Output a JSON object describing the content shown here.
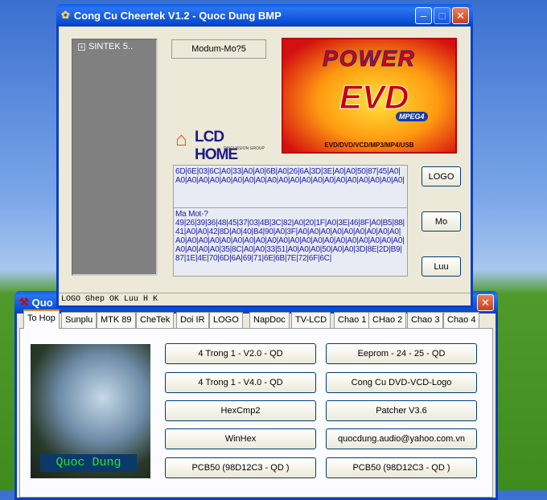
{
  "main_window": {
    "title": "Cong Cu Cheertek V1.2 - Quoc Dung BMP",
    "tree_item": "SINTEK 5..",
    "modum_button": "Modum-Mo?5",
    "banner": {
      "power": "POWER",
      "evd": "EVD",
      "mpeg": "MPEG4",
      "formats": "EVD/DVD/VCD/MP3/MP4/USB"
    },
    "lcd_logo": {
      "brand": "LCD HOME",
      "sub": "DISCUSSION GROUP"
    },
    "data_box1": "6D|6E|03|6C|A0|33|A0|A0|6B|A0|26|6A|3D|3E|A0|A0|50|87|45|A0|A0|A0|A0|A0|A0|A0|A0|A0|A0|A0|A0|A0|A0|A0|A0|A0|A0|A0|A0|A0|",
    "data_box2_label": "Ma Mot-?",
    "data_box2": "49|26|39|36|48|45|37|03|4B|3C|82|A0|20|1F|A0|3E|46|8F|A0|B5|88|41|A0|A0|42|8D|A0|40|B4|90|A0|3F|A0|A0|A0|A0|A0|A0|A0|A0|A0|A0|A0|A0|A0|A0|A0|A0|A0|A0|A0|A0|A0|A0|A0|A0|A0|A0|A0|A0|A0|A0|A0|A0|A0|35|8C|A0|A0|33|51|A0|A0|A0|50|A0|A0|3D|8E|2D|B9|87|1E|4E|70|6D|6A|69|71|6E|6B|7E|72|6F|6C|",
    "buttons": {
      "logo": "LOGO",
      "mo": "Mo",
      "luu": "Luu"
    },
    "status": "LOGO Ghep OK Luu H K"
  },
  "second_window": {
    "title_partial": "Quo",
    "tabs": [
      "To Hop",
      "Sunplu",
      "MTK 89",
      "CheTek",
      "Doi IR",
      "LOGO",
      "NapDoc",
      "TV-LCD",
      "Chao 1",
      "CHao 2",
      "Chao 3",
      "Chao 4"
    ],
    "photo_caption": "Quoc Dung",
    "buttons_left": [
      "4 Trong 1 - V2.0 - QD",
      "4 Trong 1 - V4.0 - QD",
      "HexCmp2",
      "WinHex",
      "PCB50 (98D12C3 - QD )"
    ],
    "buttons_right": [
      "Eeprom - 24 - 25 - QD",
      "Cong Cu DVD-VCD-Logo",
      "Patcher V3.6",
      "quocdung.audio@yahoo.com.vn",
      "PCB50 (98D12C3 - QD )"
    ]
  }
}
